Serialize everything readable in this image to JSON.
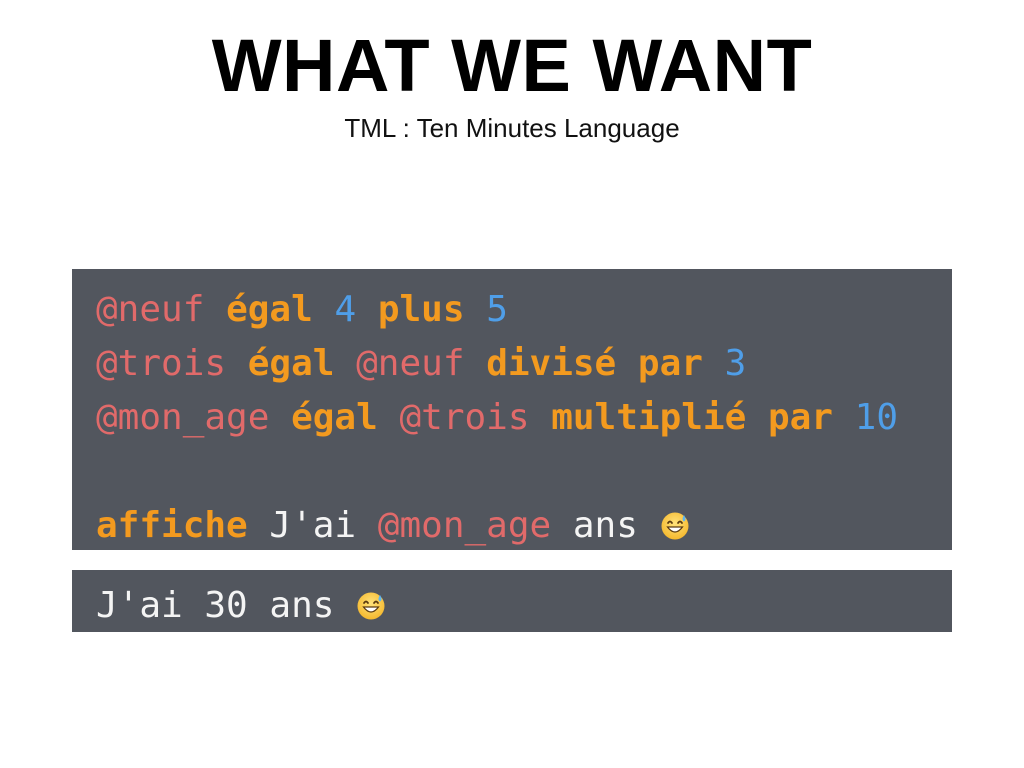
{
  "title": "WHAT WE WANT",
  "subtitle": "TML : Ten Minutes Language",
  "code": {
    "line1": {
      "var": "@neuf",
      "kw1": "égal",
      "num1": "4",
      "kw2": "plus",
      "num2": "5"
    },
    "line2": {
      "var": "@trois",
      "kw1": "égal",
      "var2": "@neuf",
      "kw2": "divisé par",
      "num": "3"
    },
    "line3": {
      "var": "@mon_age",
      "kw1": "égal",
      "var2": "@trois",
      "kw2": "multiplié par",
      "num": "10"
    },
    "line5": {
      "kw": "affiche",
      "text1": "J'ai",
      "var": "@mon_age",
      "text2": "ans",
      "icon": "grinning-sweat-emoji-icon"
    }
  },
  "output": {
    "text": "J'ai 30 ans",
    "icon": "grinning-sweat-emoji-icon"
  },
  "colors": {
    "background": "#ffffff",
    "code_background": "#52565e",
    "variable": "#e16a6a",
    "keyword": "#f39a1f",
    "number": "#4f9ee8",
    "text": "#f4f4f4"
  }
}
